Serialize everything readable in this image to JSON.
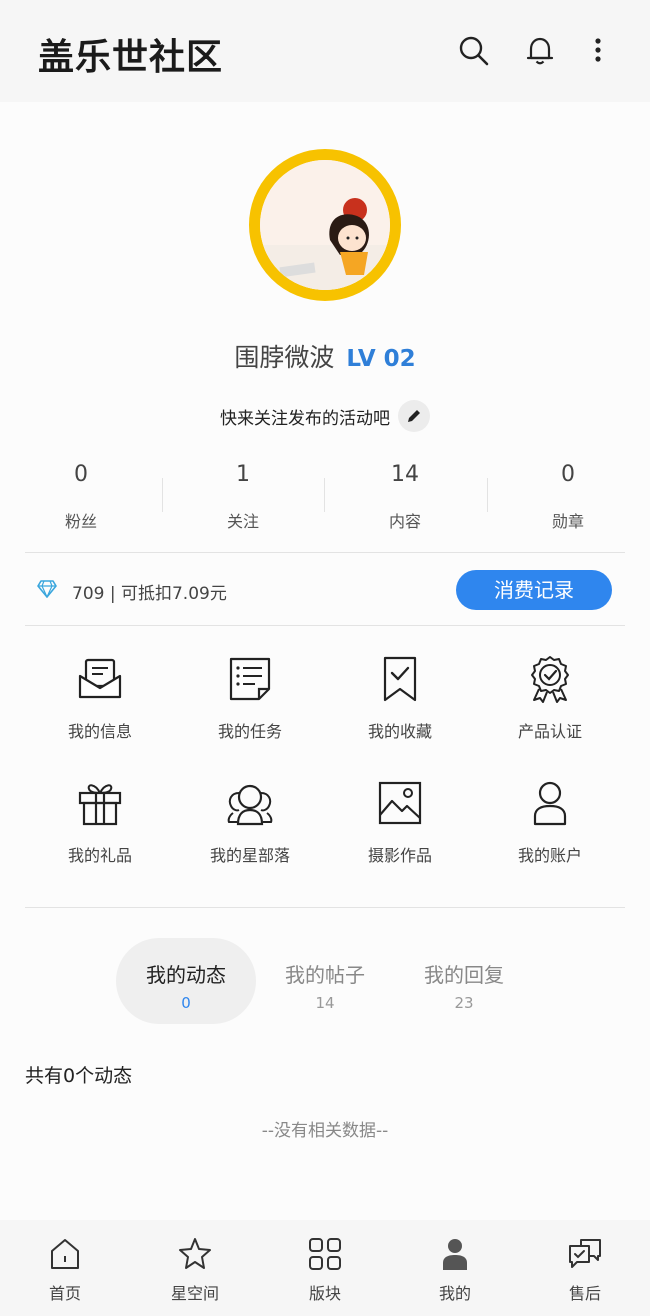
{
  "header": {
    "title": "盖乐世社区",
    "icons": [
      "search-icon",
      "bell-icon",
      "more-icon"
    ]
  },
  "profile": {
    "username": "围脖微波",
    "level": "LV 02",
    "bio": "快来关注发布的活动吧"
  },
  "stats": [
    {
      "value": "0",
      "label": "粉丝"
    },
    {
      "value": "1",
      "label": "关注"
    },
    {
      "value": "14",
      "label": "内容"
    },
    {
      "value": "0",
      "label": "勋章"
    }
  ],
  "points": {
    "text": "709 | 可抵扣7.09元",
    "button": "消费记录",
    "accent": "#2f86ee"
  },
  "grid": [
    {
      "label": "我的信息",
      "icon": "message-icon"
    },
    {
      "label": "我的任务",
      "icon": "task-list-icon"
    },
    {
      "label": "我的收藏",
      "icon": "bookmark-icon"
    },
    {
      "label": "产品认证",
      "icon": "certificate-icon"
    },
    {
      "label": "我的礼品",
      "icon": "gift-icon"
    },
    {
      "label": "我的星部落",
      "icon": "group-icon"
    },
    {
      "label": "摄影作品",
      "icon": "photo-icon"
    },
    {
      "label": "我的账户",
      "icon": "user-icon"
    }
  ],
  "tabs": [
    {
      "label": "我的动态",
      "count": "0",
      "active": true
    },
    {
      "label": "我的帖子",
      "count": "14",
      "active": false
    },
    {
      "label": "我的回复",
      "count": "23",
      "active": false
    }
  ],
  "feed": {
    "count_text": "共有0个动态",
    "empty_text": "--没有相关数据--"
  },
  "nav": [
    {
      "label": "首页",
      "icon": "home-icon"
    },
    {
      "label": "星空间",
      "icon": "star-icon"
    },
    {
      "label": "版块",
      "icon": "grid-icon"
    },
    {
      "label": "我的",
      "icon": "person-icon",
      "active": true
    },
    {
      "label": "售后",
      "icon": "chat-icon"
    }
  ]
}
